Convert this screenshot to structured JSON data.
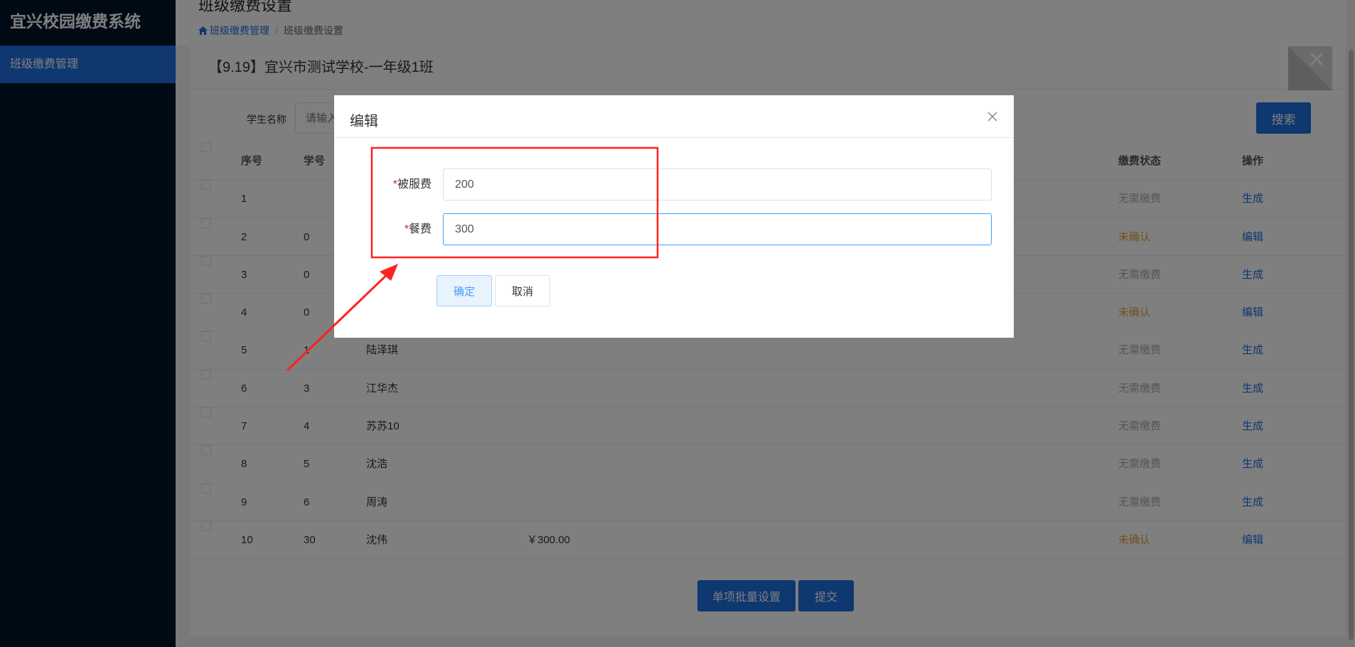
{
  "app": {
    "title": "宜兴校园缴费系统"
  },
  "sidebar": {
    "items": [
      {
        "label": "班级缴费管理"
      }
    ]
  },
  "header": {
    "title": "班级缴费设置",
    "breadcrumb": [
      "班级缴费管理",
      "班级缴费设置"
    ],
    "breadcrumb_separator": "/"
  },
  "card": {
    "title": "【9.19】宜兴市测试学校-一年级1班"
  },
  "filter": {
    "label": "学生名称",
    "placeholder": "请输入",
    "search_label": "搜索"
  },
  "table": {
    "headers": {
      "index": "序号",
      "number": "学号",
      "status": "缴费状态",
      "operation": "操作"
    },
    "rows": [
      {
        "index": "1",
        "number": "",
        "name": "",
        "amount": "",
        "status": "无需缴费",
        "op": "生成",
        "state": "none"
      },
      {
        "index": "2",
        "number": "0",
        "name": "",
        "amount": "",
        "status": "未确认",
        "op": "编辑",
        "state": "pending"
      },
      {
        "index": "3",
        "number": "0",
        "name": "",
        "amount": "",
        "status": "无需缴费",
        "op": "生成",
        "state": "none"
      },
      {
        "index": "4",
        "number": "0",
        "name": "",
        "amount": "",
        "status": "未确认",
        "op": "编辑",
        "state": "pending"
      },
      {
        "index": "5",
        "number": "1",
        "name": "陆泽琪",
        "amount": "",
        "status": "无需缴费",
        "op": "生成",
        "state": "none"
      },
      {
        "index": "6",
        "number": "3",
        "name": "江华杰",
        "amount": "",
        "status": "无需缴费",
        "op": "生成",
        "state": "none"
      },
      {
        "index": "7",
        "number": "4",
        "name": "苏苏10",
        "amount": "",
        "status": "无需缴费",
        "op": "生成",
        "state": "none"
      },
      {
        "index": "8",
        "number": "5",
        "name": "沈浩",
        "amount": "",
        "status": "无需缴费",
        "op": "生成",
        "state": "none"
      },
      {
        "index": "9",
        "number": "6",
        "name": "周涛",
        "amount": "",
        "status": "无需缴费",
        "op": "生成",
        "state": "none"
      },
      {
        "index": "10",
        "number": "30",
        "name": "沈伟",
        "amount": "￥300.00",
        "status": "未确认",
        "op": "编辑",
        "state": "pending"
      }
    ]
  },
  "footer": {
    "batch_label": "单项批量设置",
    "submit_label": "提交"
  },
  "modal": {
    "title": "编辑",
    "fields": [
      {
        "required_mark": "*",
        "label": "被服费",
        "value": "200"
      },
      {
        "required_mark": "*",
        "label": "餐费",
        "value": "300"
      }
    ],
    "confirm_label": "确定",
    "cancel_label": "取消"
  },
  "colors": {
    "sidebar": "#001529",
    "primary": "#1e6fe0",
    "pending": "#e6a23c",
    "annotation": "#ff2020"
  }
}
